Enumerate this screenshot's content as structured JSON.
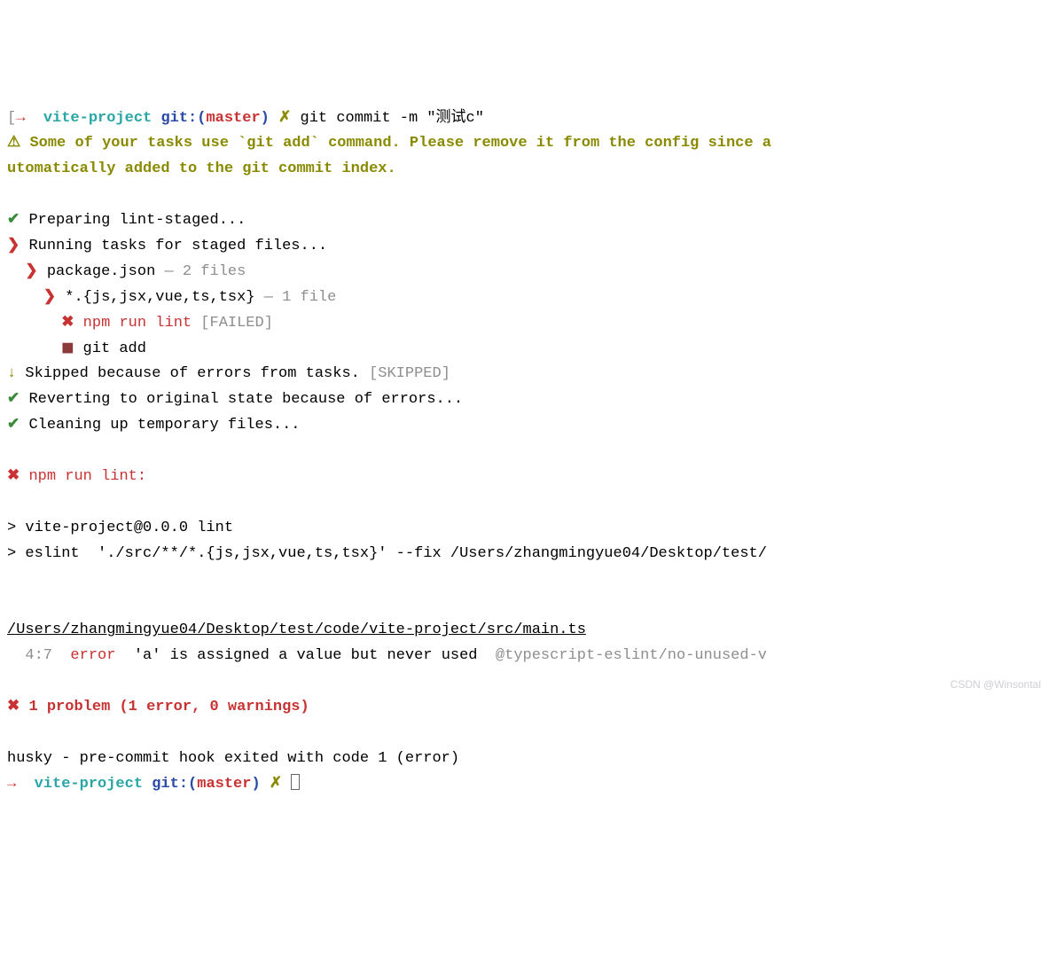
{
  "prompt1": {
    "bracket": "[",
    "arrow": "→",
    "project": "vite-project",
    "git_label": "git:",
    "paren_open": "(",
    "branch": "master",
    "paren_close": ")",
    "dirty": "✗",
    "command": "git commit -m \"测试c\""
  },
  "warn": {
    "icon": "⚠",
    "line1": "Some of your tasks use `git add` command. Please remove it from the config since a",
    "line2": "utomatically added to the git commit index."
  },
  "steps": {
    "preparing": {
      "icon": "✔",
      "text": "Preparing lint-staged..."
    },
    "running": {
      "icon": "❯",
      "text": "Running tasks for staged files..."
    },
    "package": {
      "icon": "❯",
      "text": "package.json",
      "suffix": " — 2 files"
    },
    "glob": {
      "icon": "❯",
      "text": "*.{js,jsx,vue,ts,tsx}",
      "suffix": " — 1 file"
    },
    "lint": {
      "icon": "✖",
      "text": "npm run lint",
      "suffix": "[FAILED]"
    },
    "gitadd": {
      "icon": "◼",
      "text": "git add"
    },
    "skipped": {
      "icon": "↓",
      "text": "Skipped because of errors from tasks.",
      "suffix": "[SKIPPED]"
    },
    "revert": {
      "icon": "✔",
      "text": "Reverting to original state because of errors..."
    },
    "clean": {
      "icon": "✔",
      "text": "Cleaning up temporary files..."
    }
  },
  "failheader": {
    "icon": "✖",
    "text": "npm run lint:"
  },
  "scriptrun": {
    "line1": "> vite-project@0.0.0 lint",
    "line2": "> eslint  './src/**/*.{js,jsx,vue,ts,tsx}' --fix /Users/zhangmingyue04/Desktop/test/"
  },
  "error_file": "/Users/zhangmingyue04/Desktop/test/code/vite-project/src/main.ts",
  "error_line": {
    "pos": "  4:7",
    "level": "error",
    "msg": "'a' is assigned a value but never used",
    "rule": "@typescript-eslint/no-unused-v"
  },
  "problem": {
    "icon": "✖",
    "text": "1 problem (1 error, 0 warnings)"
  },
  "husky": "husky - pre-commit hook exited with code 1 (error)",
  "prompt2": {
    "arrow": "→",
    "project": "vite-project",
    "git_label": "git:",
    "paren_open": "(",
    "branch": "master",
    "paren_close": ")",
    "dirty": "✗"
  },
  "watermark": "CSDN @Winsontal"
}
